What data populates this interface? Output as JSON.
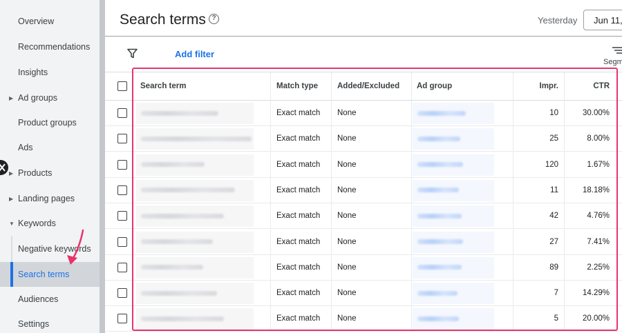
{
  "sidebar": {
    "items": [
      {
        "label": "Overview",
        "caret": false
      },
      {
        "label": "Recommendations",
        "caret": false
      },
      {
        "label": "Insights",
        "caret": false
      },
      {
        "label": "Ad groups",
        "caret": true
      },
      {
        "label": "Product groups",
        "caret": false
      },
      {
        "label": "Ads",
        "caret": false
      },
      {
        "label": "Products",
        "caret": true
      },
      {
        "label": "Landing pages",
        "caret": true
      },
      {
        "label": "Keywords",
        "caret": true,
        "expanded": true
      },
      {
        "label": "Negative keywords",
        "caret": false
      },
      {
        "label": "Search terms",
        "caret": false,
        "active": true
      },
      {
        "label": "Audiences",
        "caret": false
      },
      {
        "label": "Settings",
        "caret": false
      }
    ]
  },
  "header": {
    "title": "Search terms",
    "help_icon": "help-circle-icon",
    "date_label": "Yesterday",
    "date_value": "Jun 11,"
  },
  "toolbar": {
    "filter_icon": "filter-icon",
    "add_filter": "Add filter",
    "segment_icon": "segment-icon",
    "segment_label": "Segm"
  },
  "table": {
    "columns": [
      "Search term",
      "Match type",
      "Added/Excluded",
      "Ad group",
      "Impr.",
      "CTR"
    ],
    "rows": [
      {
        "match_type": "Exact match",
        "added": "None",
        "impr": "10",
        "ctr": "30.00%"
      },
      {
        "match_type": "Exact match",
        "added": "None",
        "impr": "25",
        "ctr": "8.00%"
      },
      {
        "match_type": "Exact match",
        "added": "None",
        "impr": "120",
        "ctr": "1.67%"
      },
      {
        "match_type": "Exact match",
        "added": "None",
        "impr": "11",
        "ctr": "18.18%"
      },
      {
        "match_type": "Exact match",
        "added": "None",
        "impr": "42",
        "ctr": "4.76%"
      },
      {
        "match_type": "Exact match",
        "added": "None",
        "impr": "27",
        "ctr": "7.41%"
      },
      {
        "match_type": "Exact match",
        "added": "None",
        "impr": "89",
        "ctr": "2.25%"
      },
      {
        "match_type": "Exact match",
        "added": "None",
        "impr": "7",
        "ctr": "14.29%"
      },
      {
        "match_type": "Exact match",
        "added": "None",
        "impr": "5",
        "ctr": "20.00%"
      }
    ]
  },
  "colors": {
    "accent": "#1a73e8",
    "highlight": "#e8336b"
  }
}
